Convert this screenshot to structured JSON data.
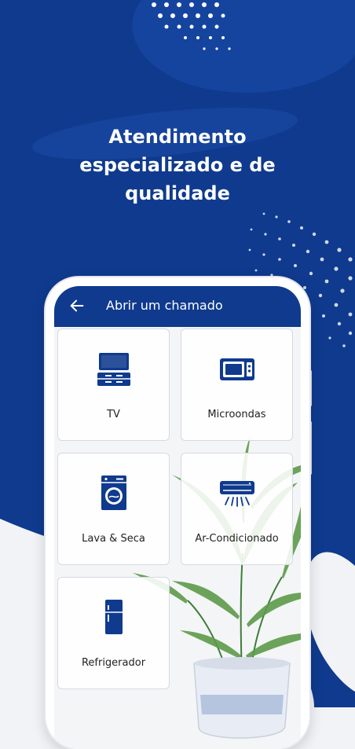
{
  "headline": {
    "line1": "Atendimento",
    "line2": "especializado e de",
    "line3": "qualidade"
  },
  "appbar": {
    "title": "Abrir um chamado",
    "back_icon": "arrow-left-icon"
  },
  "categories": [
    {
      "label": "TV",
      "icon": "tv-icon"
    },
    {
      "label": "Microondas",
      "icon": "microwave-icon"
    },
    {
      "label": "Lava & Seca",
      "icon": "washing-machine-icon"
    },
    {
      "label": "Ar-Condicionado",
      "icon": "air-conditioner-icon"
    },
    {
      "label": "Refrigerador",
      "icon": "refrigerator-icon"
    }
  ],
  "colors": {
    "brand_blue": "#0f3a8e",
    "background": "#f2f3f6"
  }
}
